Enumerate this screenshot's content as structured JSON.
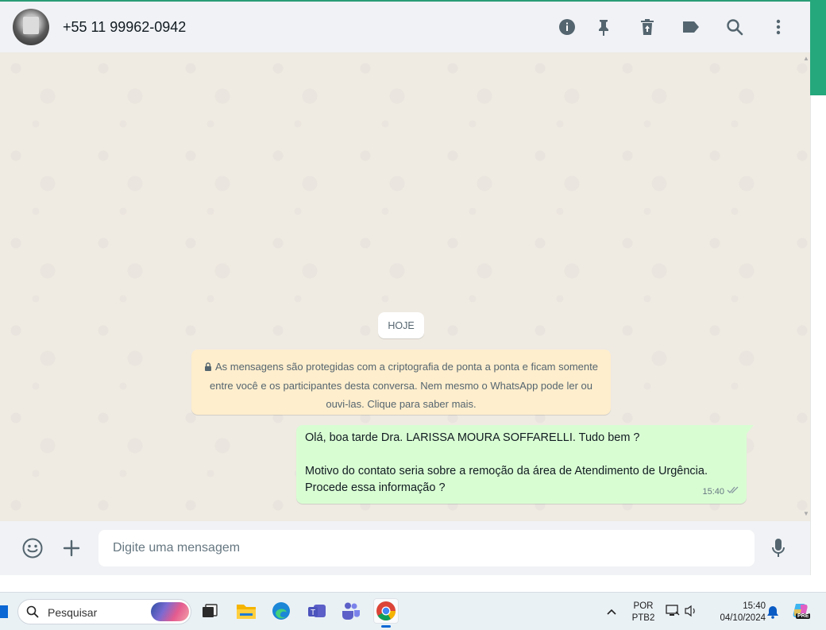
{
  "header": {
    "contact_name": "+55 11 99962-0942",
    "icons": [
      "info-icon",
      "pin-icon",
      "delete-icon",
      "label-icon",
      "search-icon",
      "menu-icon"
    ]
  },
  "chat": {
    "date_chip": "HOJE",
    "encryption_notice": "As mensagens são protegidas com a criptografia de ponta a ponta e ficam somente entre você e os participantes desta conversa. Nem mesmo o WhatsApp pode ler ou ouvi-las. Clique para saber mais.",
    "messages": [
      {
        "direction": "outgoing",
        "line1": "Olá, boa tarde Dra. LARISSA MOURA SOFFARELLI. Tudo bem ?",
        "line2": "Motivo do contato seria sobre a remoção da área de Atendimento de Urgência. Procede essa informação ?",
        "time": "15:40",
        "status": "delivered"
      }
    ]
  },
  "composer": {
    "placeholder": "Digite uma mensagem",
    "value": ""
  },
  "taskbar": {
    "search_label": "Pesquisar",
    "language_line1": "POR",
    "language_line2": "PTB2",
    "time": "15:40",
    "date": "04/10/2024",
    "copilot_badge": "PRE"
  },
  "colors": {
    "outgoing_bubble": "#d9fdd3",
    "notice_bg": "#ffeecd",
    "chat_bg": "#efeae2",
    "header_bg": "#f0f2f5",
    "accent": "#25a87c"
  }
}
